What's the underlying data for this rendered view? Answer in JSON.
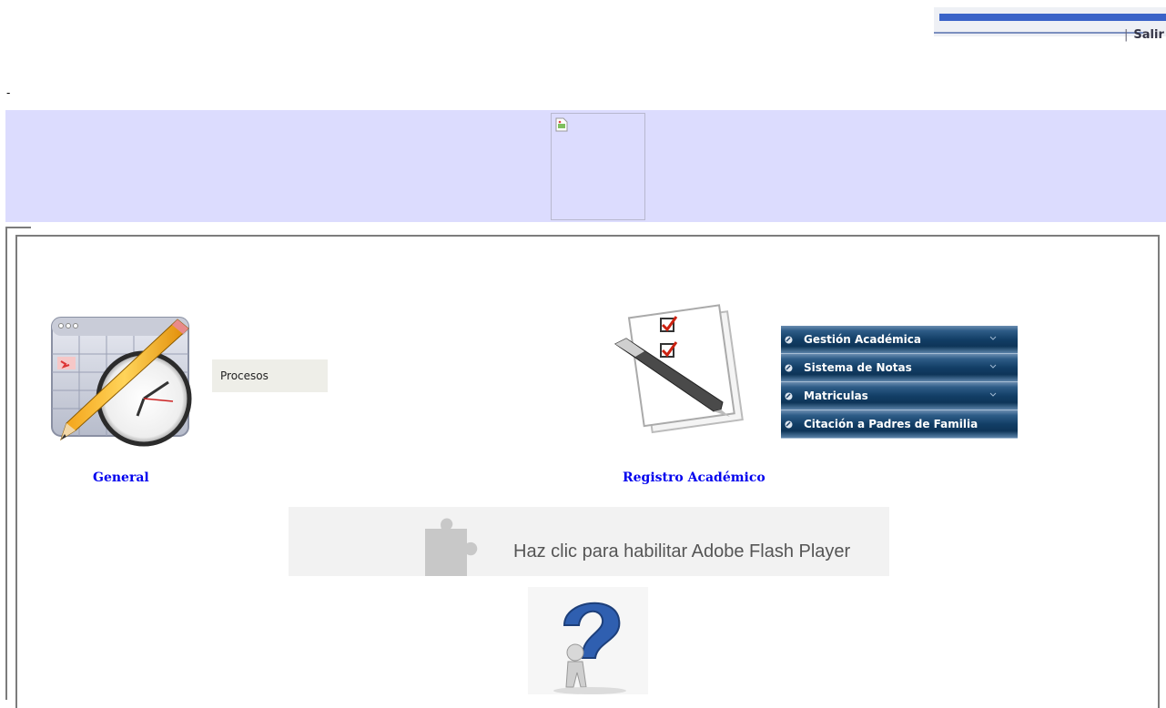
{
  "header": {
    "logout_label": "Salir",
    "separator": "|"
  },
  "misc": {
    "dash": "-"
  },
  "banner": {
    "background": "#dcdcfe"
  },
  "modules": {
    "general": {
      "label": "General",
      "icon": "calendar-clock-pencil-icon",
      "submenu": [
        "Procesos"
      ]
    },
    "registro": {
      "label": "Registro Académico",
      "icon": "checklist-pen-icon"
    }
  },
  "menu": {
    "items": [
      {
        "label": "Gestión Académica",
        "has_submenu": true
      },
      {
        "label": "Sistema de Notas",
        "has_submenu": true
      },
      {
        "label": "Matriculas",
        "has_submenu": true
      },
      {
        "label": "Citación a Padres de Familia",
        "has_submenu": false
      }
    ],
    "color": "#123e66"
  },
  "flash": {
    "message": "Haz clic para habilitar Adobe Flash Player",
    "icon": "puzzle-plugin-icon"
  },
  "help": {
    "icon": "question-mark-figure-icon"
  },
  "colors": {
    "link": "#0000ee",
    "accent": "#3a63c8"
  }
}
